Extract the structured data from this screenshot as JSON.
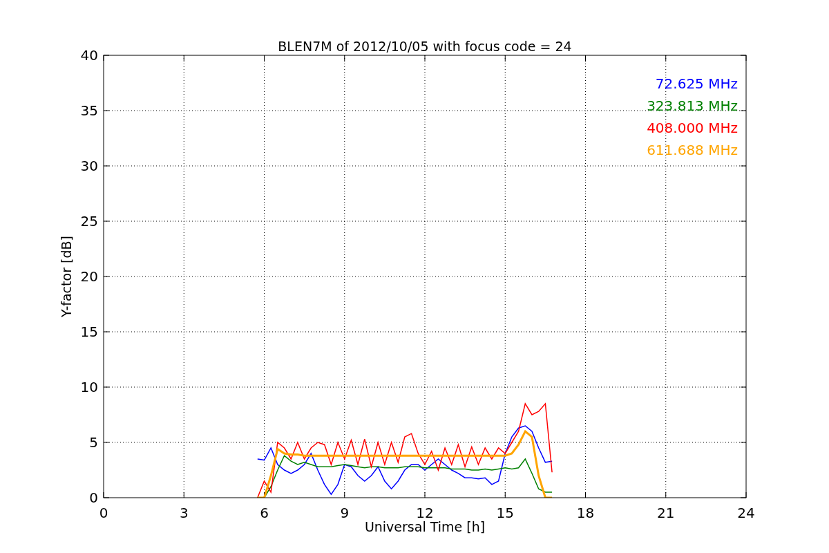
{
  "figure": {
    "chart_data": {
      "type": "line",
      "title": "BLEN7M of 2012/10/05 with focus code = 24",
      "xlabel": "Universal Time [h]",
      "ylabel": "Y-factor [dB]",
      "x": [
        5.75,
        6,
        6.25,
        6.5,
        6.75,
        7,
        7.25,
        7.5,
        7.75,
        8,
        8.25,
        8.5,
        8.75,
        9,
        9.25,
        9.5,
        9.75,
        10,
        10.25,
        10.5,
        10.75,
        11,
        11.25,
        11.5,
        11.75,
        12,
        12.25,
        12.5,
        12.75,
        13,
        13.25,
        13.5,
        13.75,
        14,
        14.25,
        14.5,
        14.75,
        15,
        15.25,
        15.5,
        15.75,
        16,
        16.25,
        16.5,
        16.75
      ],
      "series": [
        {
          "name": "72.625 MHz",
          "color": "#0000ff",
          "values": [
            3.5,
            3.4,
            4.5,
            3,
            2.5,
            2.2,
            2.5,
            3,
            4,
            2.5,
            1.2,
            0.3,
            1.2,
            3,
            2.8,
            2,
            1.5,
            2,
            2.8,
            1.5,
            0.8,
            1.5,
            2.5,
            3,
            3,
            2.5,
            3,
            3.5,
            3,
            2.5,
            2.2,
            1.8,
            1.8,
            1.7,
            1.8,
            1.2,
            1.5,
            4,
            5.5,
            6.3,
            6.5,
            6,
            4.5,
            3.2,
            3.3
          ]
        },
        {
          "name": "323.813 MHz",
          "color": "#008000",
          "values": [
            0,
            0,
            1,
            2.5,
            3.8,
            3.3,
            3,
            3.2,
            3,
            2.8,
            2.8,
            2.8,
            2.9,
            3,
            2.9,
            2.8,
            2.7,
            2.8,
            2.8,
            2.7,
            2.7,
            2.7,
            2.8,
            2.8,
            2.8,
            2.7,
            2.7,
            2.7,
            2.7,
            2.6,
            2.6,
            2.6,
            2.5,
            2.5,
            2.6,
            2.5,
            2.6,
            2.7,
            2.6,
            2.7,
            3.5,
            2.2,
            0.8,
            0.5,
            0.5
          ]
        },
        {
          "name": "408.000 MHz",
          "color": "#ff0000",
          "values": [
            0,
            1.5,
            0.5,
            5,
            4.5,
            3.5,
            5,
            3.5,
            4.5,
            5,
            4.8,
            3,
            5,
            3.5,
            5.2,
            3,
            5.3,
            2.8,
            5,
            3,
            5,
            3.2,
            5.5,
            5.8,
            4,
            3,
            4.2,
            2.5,
            4.5,
            3,
            4.8,
            2.8,
            4.6,
            3,
            4.5,
            3.5,
            4.5,
            4,
            5,
            6,
            8.5,
            7.5,
            7.8,
            8.5,
            2.3
          ]
        },
        {
          "name": "611.688 MHz",
          "color": "#ffa500",
          "values": [
            0,
            0,
            2,
            4.4,
            4,
            3.9,
            3.9,
            3.8,
            3.8,
            3.8,
            3.8,
            3.8,
            3.8,
            3.8,
            3.8,
            3.8,
            3.8,
            3.8,
            3.8,
            3.8,
            3.8,
            3.8,
            3.8,
            3.8,
            3.8,
            3.8,
            3.8,
            3.8,
            3.8,
            3.8,
            3.8,
            3.8,
            3.8,
            3.8,
            3.8,
            3.8,
            3.8,
            3.8,
            4,
            4.8,
            6,
            5.5,
            2,
            0,
            0
          ]
        }
      ],
      "xlim": [
        0,
        24
      ],
      "ylim": [
        0,
        40
      ],
      "xticks": [
        0,
        3,
        6,
        9,
        12,
        15,
        18,
        21,
        24
      ],
      "yticks": [
        0,
        5,
        10,
        15,
        20,
        25,
        30,
        35,
        40
      ],
      "grid": true
    }
  }
}
